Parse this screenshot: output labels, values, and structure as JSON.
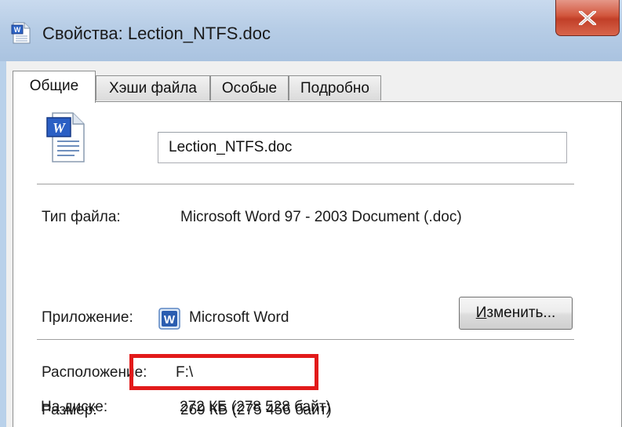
{
  "window": {
    "title": "Свойства: Lection_NTFS.doc",
    "close_glyph": "X"
  },
  "tabs": [
    {
      "label": "Общие",
      "active": true
    },
    {
      "label": "Хэши файла",
      "active": false
    },
    {
      "label": "Особые",
      "active": false
    },
    {
      "label": "Подробно",
      "active": false
    }
  ],
  "general": {
    "file_name": "Lection_NTFS.doc",
    "file_type_label": "Тип файла:",
    "file_type_value": "Microsoft Word 97 - 2003 Document (.doc)",
    "app_label": "Приложение:",
    "app_value": "Microsoft Word",
    "change_button_hotkey": "И",
    "change_button_rest": "зменить...",
    "location_label": "Расположение:",
    "location_value": "F:\\",
    "size_label": "Размер:",
    "size_value": "269 КБ (275 456 байт)",
    "on_disk_label": "На диске:",
    "on_disk_value": "272 КБ (278 528 байт)"
  },
  "icons": {
    "title": "word-document-icon",
    "document": "word-document-icon",
    "app": "word-app-icon"
  },
  "colors": {
    "highlight": "#e21a1a",
    "titlebar": "#b9d1ea",
    "close": "#c7452d",
    "word_blue": "#2b579a"
  }
}
